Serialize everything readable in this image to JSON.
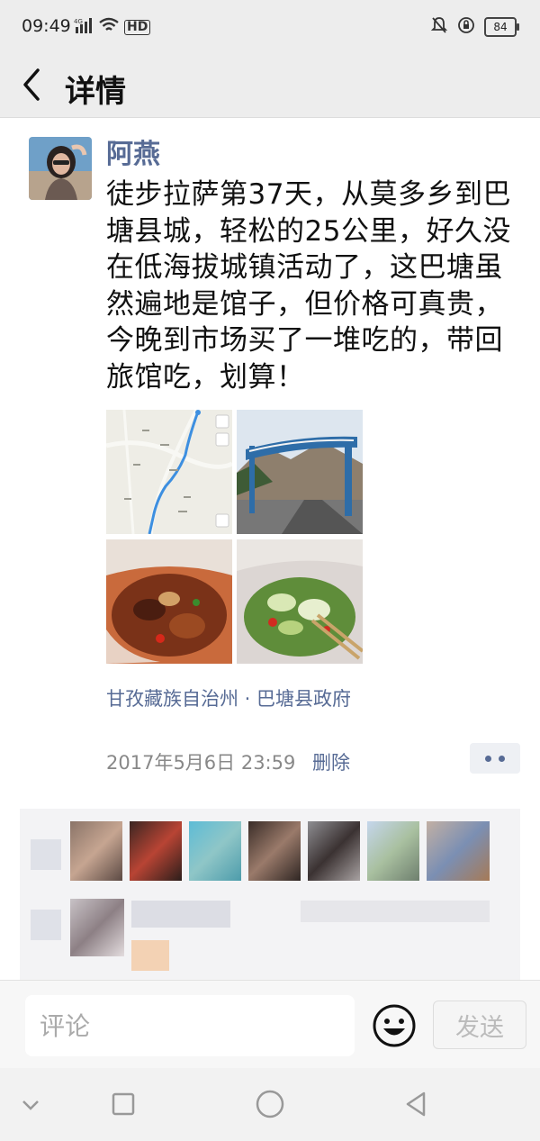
{
  "status_bar": {
    "time": "09:49",
    "network": "4G",
    "hd": "HD",
    "battery": "84",
    "icons": [
      "signal-icon",
      "wifi-icon",
      "mute-icon",
      "rotation-lock-icon",
      "battery-icon"
    ]
  },
  "header": {
    "title": "详情",
    "back_icon": "back-arrow-icon"
  },
  "post": {
    "author": "阿燕",
    "text": "徒步拉萨第37天，从莫多乡到巴塘县城，轻松的25公里，好久没在低海拔城镇活动了，这巴塘虽然遍地是馆子，但价格可真贵，今晚到市场买了一堆吃的，带回旅馆吃，划算！",
    "photos": [
      "map-screenshot",
      "town-entrance-gate",
      "takeout-food-bag-meat",
      "takeout-food-bag-vegetables"
    ],
    "location": "甘孜藏族自治州 · 巴塘县政府",
    "timestamp": "2017年5月6日 23:59",
    "delete_label": "删除"
  },
  "comment_bar": {
    "placeholder": "评论",
    "send_label": "发送",
    "emoji_icon": "emoji-icon"
  },
  "nav_bar": {
    "icons": [
      "nav-down-icon",
      "nav-recents-icon",
      "nav-home-icon",
      "nav-back-icon"
    ]
  },
  "colors": {
    "link": "#576b95",
    "header_bg": "#ededed",
    "panel_bg": "#f3f3f5"
  }
}
